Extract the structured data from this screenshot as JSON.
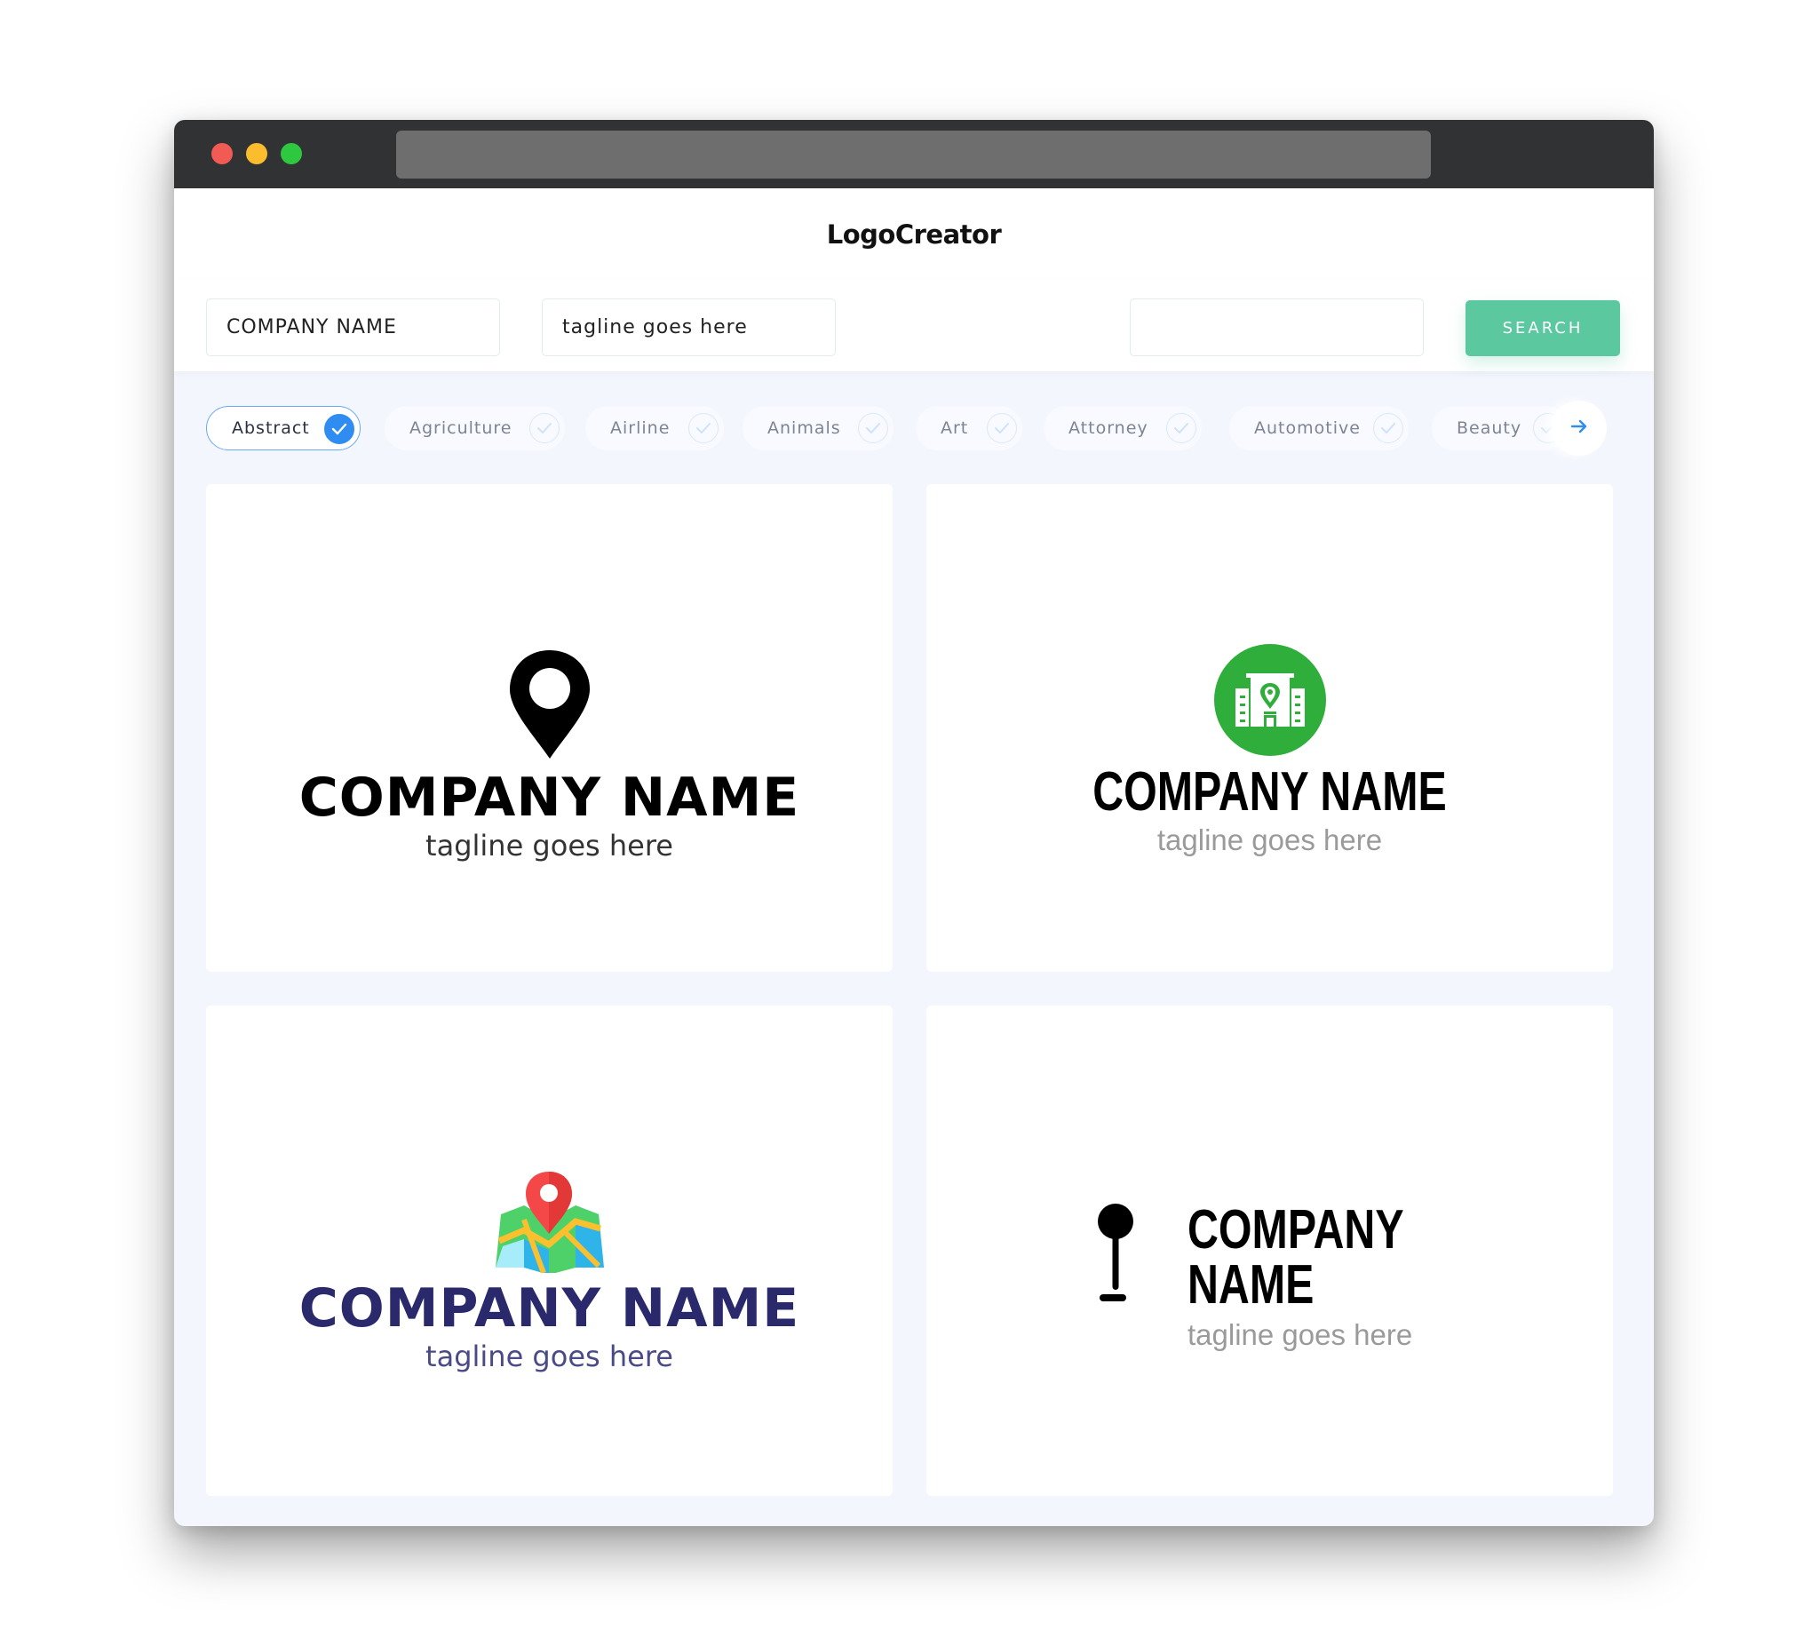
{
  "header": {
    "title": "LogoCreator"
  },
  "search": {
    "company_value": "COMPANY NAME",
    "tagline_value": "tagline goes here",
    "keyword_value": "",
    "button_label": "SEARCH"
  },
  "filters": {
    "items": [
      {
        "label": "Abstract",
        "selected": true
      },
      {
        "label": "Agriculture",
        "selected": false
      },
      {
        "label": "Airline",
        "selected": false
      },
      {
        "label": "Animals",
        "selected": false
      },
      {
        "label": "Art",
        "selected": false
      },
      {
        "label": "Attorney",
        "selected": false
      },
      {
        "label": "Automotive",
        "selected": false
      },
      {
        "label": "Beauty",
        "selected": false
      }
    ],
    "next_icon": "arrow-right-icon"
  },
  "logos": [
    {
      "icon": "map-pin-icon",
      "company": "COMPANY NAME",
      "tagline": "tagline goes here",
      "name_color": "#000000",
      "tagline_color": "#333333"
    },
    {
      "icon": "building-location-icon",
      "company": "COMPANY NAME",
      "tagline": "tagline goes here",
      "name_color": "#000000",
      "tagline_color": "#9a9a9a",
      "accent": "#2fae3c"
    },
    {
      "icon": "folded-map-pin-icon",
      "company": "COMPANY NAME",
      "tagline": "tagline goes here",
      "name_color": "#29296b",
      "tagline_color": "#4a4a86"
    },
    {
      "icon": "round-pin-icon",
      "company": "COMPANY NAME",
      "tagline": "tagline goes here",
      "name_color": "#000000",
      "tagline_color": "#9a9a9a"
    }
  ],
  "colors": {
    "accent_green": "#5bc8a0",
    "accent_blue": "#2f8cf0",
    "titlebar": "#313234",
    "page_bg": "#f3f6fd"
  }
}
